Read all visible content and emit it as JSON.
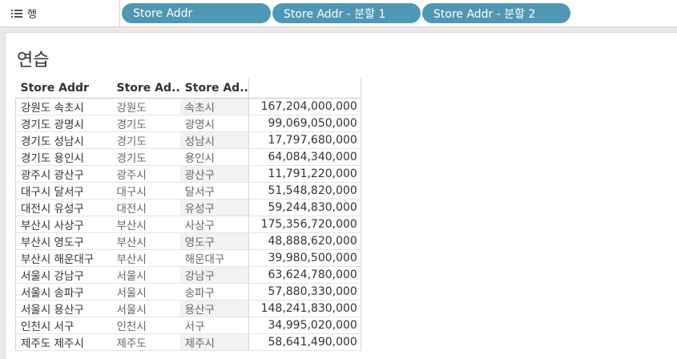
{
  "shelf": {
    "label": "행",
    "pills": [
      "Store Addr",
      "Store Addr - 분할 1",
      "Store Addr - 분할 2"
    ]
  },
  "sheet": {
    "title": "연습",
    "columns": [
      "Store Addr",
      "Store Ad..",
      "Store Ad..",
      ""
    ],
    "rows": [
      [
        "강원도 속초시",
        "강원도",
        "속초시",
        "167,204,000,000"
      ],
      [
        "경기도 광명시",
        "경기도",
        "광명시",
        "99,069,050,000"
      ],
      [
        "경기도 성남시",
        "경기도",
        "성남시",
        "17,797,680,000"
      ],
      [
        "경기도 용인시",
        "경기도",
        "용인시",
        "64,084,340,000"
      ],
      [
        "광주시 광산구",
        "광주시",
        "광산구",
        "11,791,220,000"
      ],
      [
        "대구시 달서구",
        "대구시",
        "달서구",
        "51,548,820,000"
      ],
      [
        "대전시 유성구",
        "대전시",
        "유성구",
        "59,244,830,000"
      ],
      [
        "부산시 사상구",
        "부산시",
        "사상구",
        "175,356,720,000"
      ],
      [
        "부산시 영도구",
        "부산시",
        "영도구",
        "48,888,620,000"
      ],
      [
        "부산시 해운대구",
        "부산시",
        "해운대구",
        "39,980,500,000"
      ],
      [
        "서울시 강남구",
        "서울시",
        "강남구",
        "63,624,780,000"
      ],
      [
        "서울시 송파구",
        "서울시",
        "송파구",
        "57,880,330,000"
      ],
      [
        "서울시 용산구",
        "서울시",
        "용산구",
        "148,241,830,000"
      ],
      [
        "인천시 서구",
        "인천시",
        "서구",
        "34,995,020,000"
      ],
      [
        "제주도 제주시",
        "제주도",
        "제주시",
        "58,641,490,000"
      ]
    ]
  }
}
